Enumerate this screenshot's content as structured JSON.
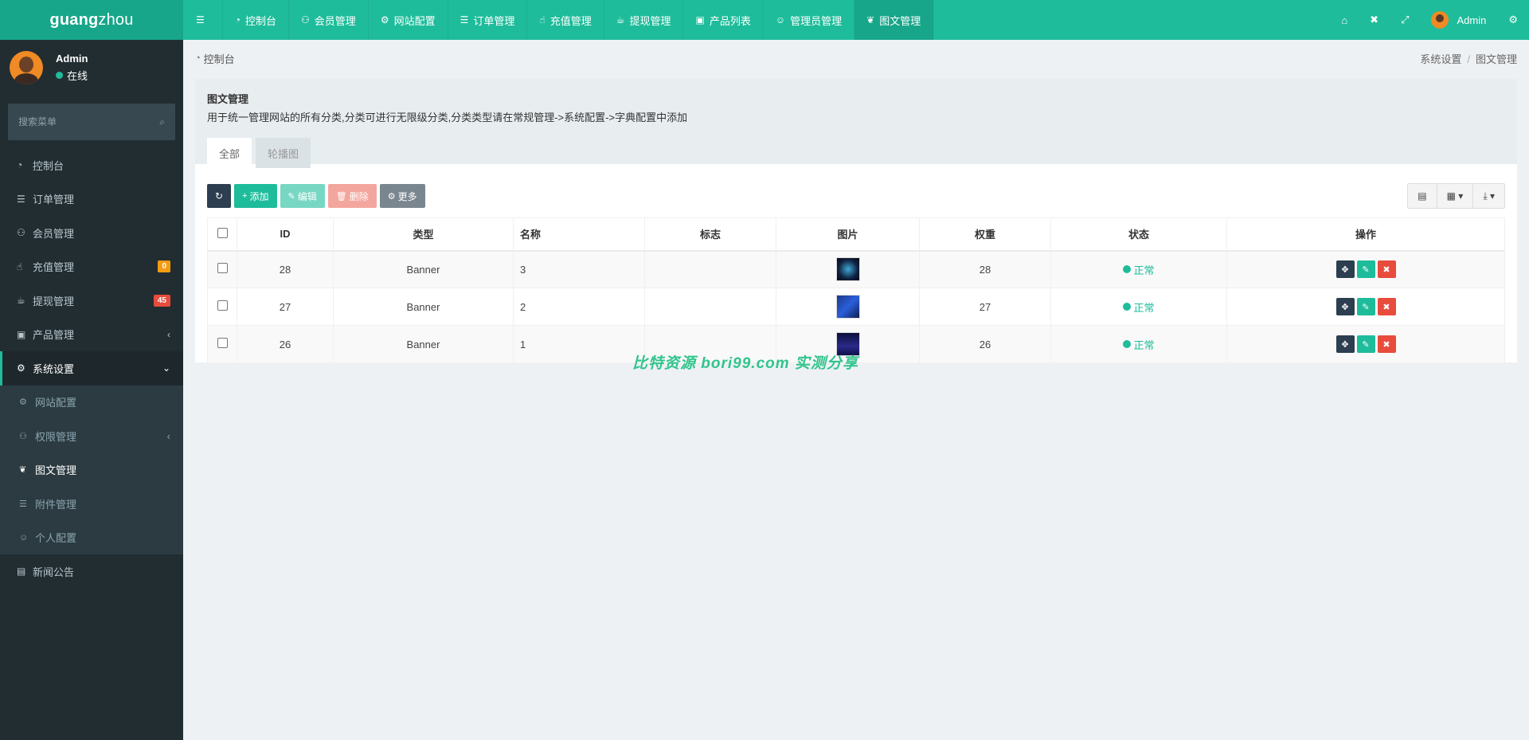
{
  "brand": {
    "bold": "guang",
    "light": "zhou"
  },
  "topnav": [
    {
      "icon": "☰",
      "label": "",
      "name": "menu-toggle-icon"
    },
    {
      "icon": "◔",
      "label": "控制台",
      "name": "dashboard-icon"
    },
    {
      "icon": "⚇",
      "label": "会员管理",
      "name": "users-icon"
    },
    {
      "icon": "⚙",
      "label": "网站配置",
      "name": "gear-icon"
    },
    {
      "icon": "☰",
      "label": "订单管理",
      "name": "list-icon"
    },
    {
      "icon": "☝",
      "label": "充值管理",
      "name": "hand-icon"
    },
    {
      "icon": "☕",
      "label": "提现管理",
      "name": "hand-point-icon"
    },
    {
      "icon": "▣",
      "label": "产品列表",
      "name": "shopping-bag-icon"
    },
    {
      "icon": "☺",
      "label": "管理员管理",
      "name": "user-icon"
    },
    {
      "icon": "❦",
      "label": "图文管理",
      "name": "leaf-icon"
    }
  ],
  "topright": {
    "home_icon": "⌂",
    "trash_icon": "✖",
    "fullscreen_icon": "⤢",
    "user_label": "Admin",
    "settings_icon": "⚙"
  },
  "user": {
    "name": "Admin",
    "status": "在线"
  },
  "sidebar_search": {
    "placeholder": "搜索菜单",
    "icon": "⌕"
  },
  "menu": [
    {
      "icon": "◔",
      "label": "控制台"
    },
    {
      "icon": "☰",
      "label": "订单管理"
    },
    {
      "icon": "⚇",
      "label": "会员管理"
    },
    {
      "icon": "☝",
      "label": "充值管理",
      "badge": "0",
      "badge_color": "#f39c12"
    },
    {
      "icon": "☕",
      "label": "提现管理",
      "badge": "45",
      "badge_color": "#e74c3c"
    },
    {
      "icon": "▣",
      "label": "产品管理",
      "caret": "‹"
    },
    {
      "icon": "⚙",
      "label": "系统设置",
      "caret": "⌄"
    }
  ],
  "submenu": [
    {
      "icon": "⚙",
      "label": "网站配置"
    },
    {
      "icon": "⚇",
      "label": "权限管理",
      "caret": "‹"
    },
    {
      "icon": "❦",
      "label": "图文管理"
    },
    {
      "icon": "☰",
      "label": "附件管理"
    },
    {
      "icon": "☺",
      "label": "个人配置"
    }
  ],
  "menu_after": {
    "icon": "▤",
    "label": "新闻公告"
  },
  "breadcrumb": {
    "left": "控制台",
    "right1": "系统设置",
    "sep": "/",
    "right2": "图文管理"
  },
  "panel": {
    "title": "图文管理",
    "desc": "用于统一管理网站的所有分类,分类可进行无限级分类,分类类型请在常规管理->系统配置->字典配置中添加",
    "tabs": [
      "全部",
      "轮播图"
    ]
  },
  "toolbar": {
    "refresh_icon": "↻",
    "add_label": "添加",
    "edit_label": "编辑",
    "delete_label": "删除",
    "more_label": "更多",
    "right_icons": [
      "▤",
      "▦ ▾",
      "⤓ ▾"
    ]
  },
  "table": {
    "headers": [
      "ID",
      "类型",
      "名称",
      "标志",
      "图片",
      "权重",
      "状态",
      "操作"
    ],
    "rows": [
      {
        "id": "28",
        "type": "Banner",
        "name": "3",
        "flag": "",
        "weight": "28",
        "status": "正常"
      },
      {
        "id": "27",
        "type": "Banner",
        "name": "2",
        "flag": "",
        "weight": "27",
        "status": "正常"
      },
      {
        "id": "26",
        "type": "Banner",
        "name": "1",
        "flag": "",
        "weight": "26",
        "status": "正常"
      }
    ]
  },
  "watermark": "比特资源 bori99.com 实测分享",
  "colors": {
    "brand": "#1ebc9b",
    "sidebar": "#222d32",
    "danger": "#e74c3c",
    "dark": "#2c3e50"
  }
}
